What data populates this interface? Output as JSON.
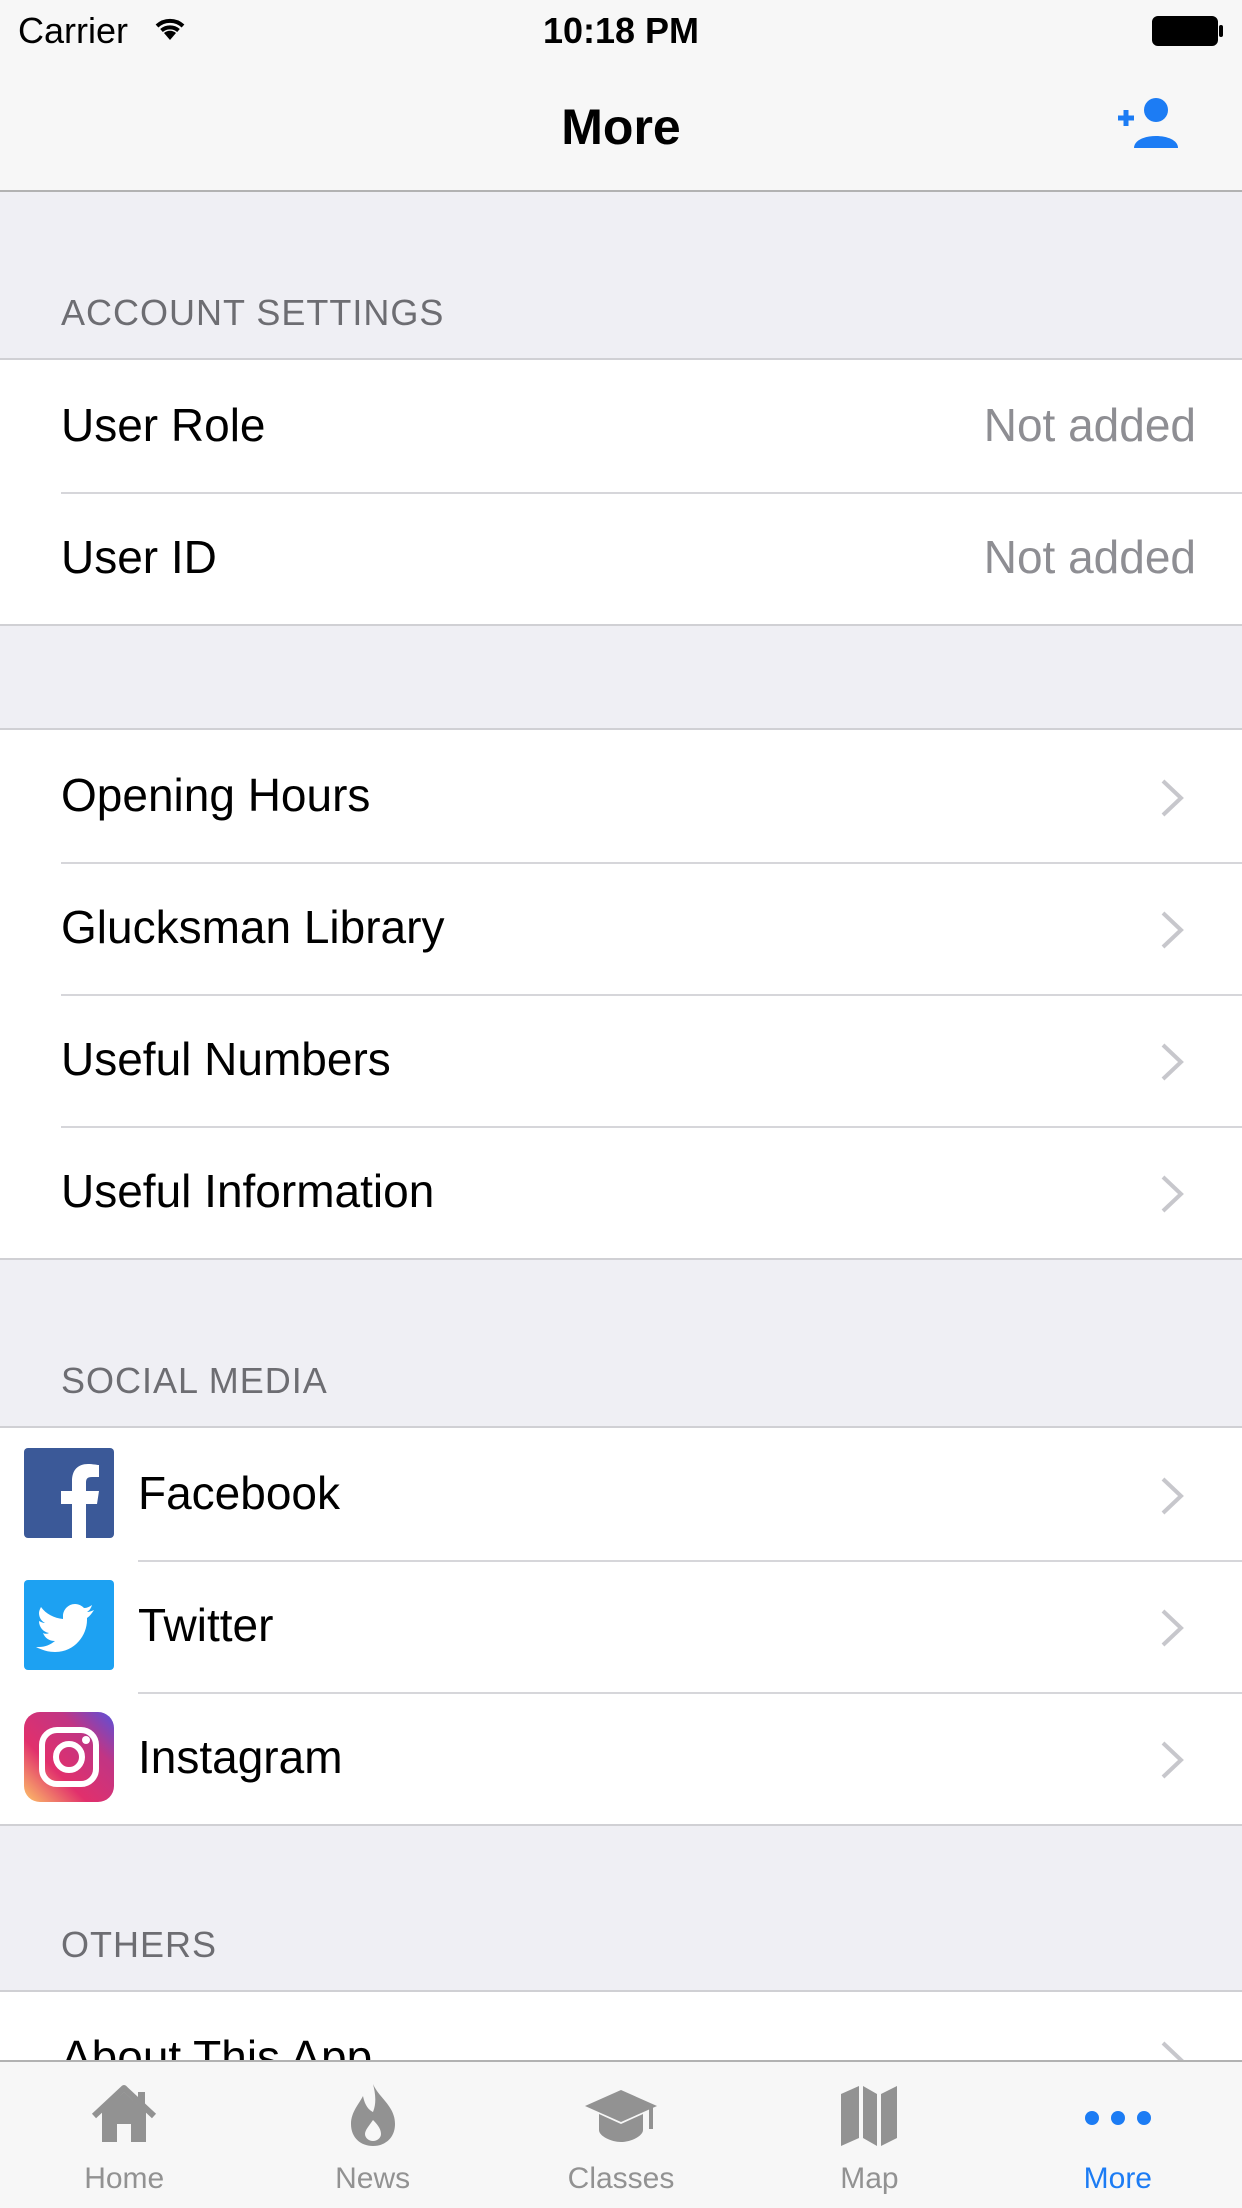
{
  "status_bar": {
    "carrier": "Carrier",
    "time": "10:18 PM"
  },
  "nav": {
    "title": "More",
    "right_icon": "add-user-icon"
  },
  "sections": {
    "account": {
      "header": "ACCOUNT SETTINGS",
      "rows": [
        {
          "label": "User Role",
          "value": "Not added"
        },
        {
          "label": "User ID",
          "value": "Not added"
        }
      ]
    },
    "info": {
      "rows": [
        {
          "label": "Opening Hours"
        },
        {
          "label": "Glucksman Library"
        },
        {
          "label": "Useful Numbers"
        },
        {
          "label": "Useful Information"
        }
      ]
    },
    "social": {
      "header": "SOCIAL MEDIA",
      "rows": [
        {
          "label": "Facebook",
          "icon": "facebook-icon",
          "color": "#3b5998"
        },
        {
          "label": "Twitter",
          "icon": "twitter-icon",
          "color": "#1da1f2"
        },
        {
          "label": "Instagram",
          "icon": "instagram-icon",
          "color": "#c13584"
        }
      ]
    },
    "others": {
      "header": "OTHERS",
      "rows": [
        {
          "label": "About This App"
        }
      ]
    }
  },
  "tab_bar": {
    "tabs": [
      {
        "label": "Home",
        "icon": "home-icon"
      },
      {
        "label": "News",
        "icon": "flame-icon"
      },
      {
        "label": "Classes",
        "icon": "graduation-cap-icon"
      },
      {
        "label": "Map",
        "icon": "map-icon"
      },
      {
        "label": "More",
        "icon": "more-dots-icon",
        "active": true
      }
    ],
    "active_color": "#1c7cf4",
    "inactive_color": "#929292"
  }
}
